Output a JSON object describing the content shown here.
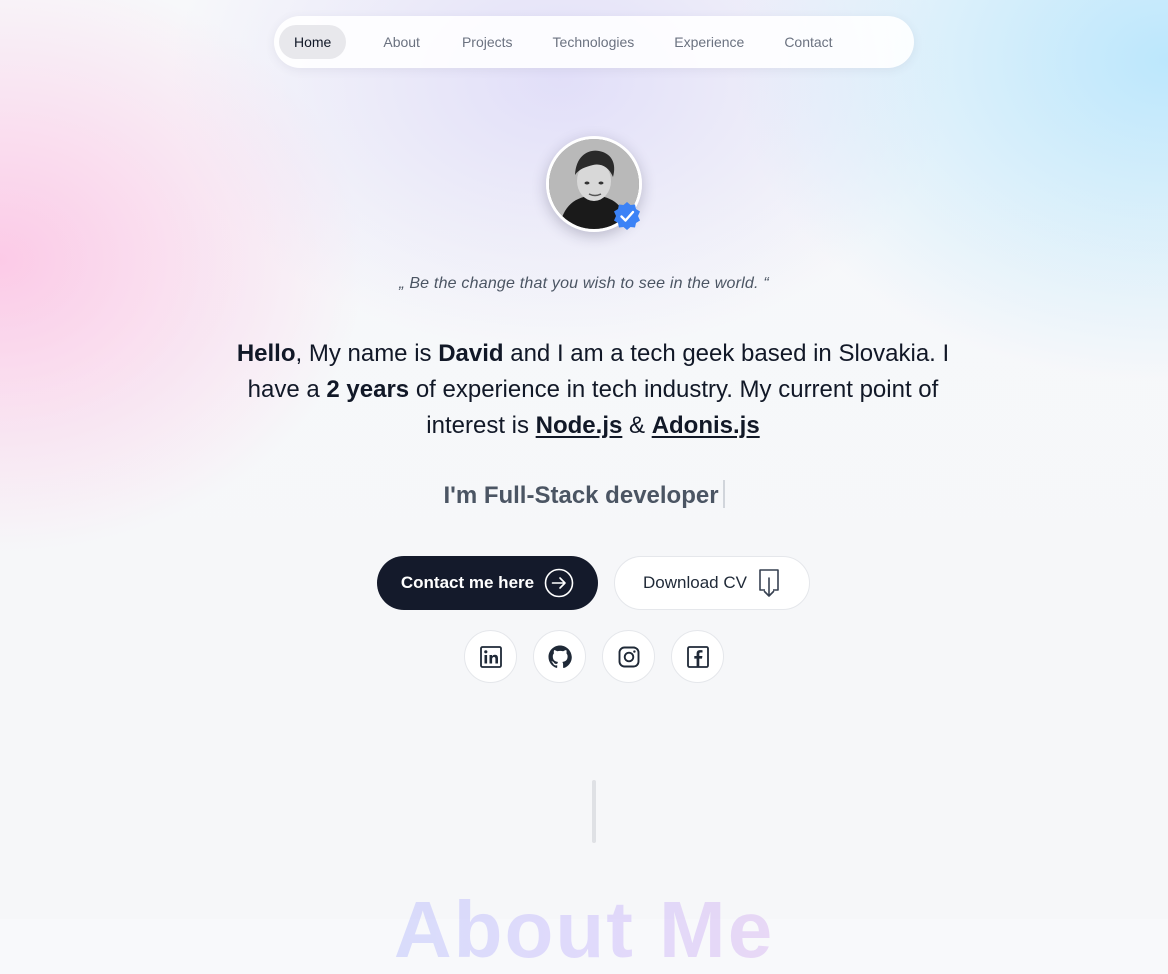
{
  "nav": {
    "items": [
      {
        "label": "Home",
        "active": true
      },
      {
        "label": "About",
        "active": false
      },
      {
        "label": "Projects",
        "active": false
      },
      {
        "label": "Technologies",
        "active": false
      },
      {
        "label": "Experience",
        "active": false
      },
      {
        "label": "Contact",
        "active": false
      }
    ]
  },
  "profile": {
    "avatar_icon": "profile-photo",
    "badge_icon": "verified-badge-icon",
    "badge_color": "#3b82f6"
  },
  "quote": "„ Be the change that you wish to see in the world. “",
  "intro": {
    "hello": "Hello",
    "part1": ", My name is ",
    "name": "David",
    "part2": " and I am a tech geek based in Slovakia. I have a ",
    "years": "2 years",
    "part3": " of experience in tech industry. My current point of interest is ",
    "tech1": "Node.js",
    "amp": " & ",
    "tech2": "Adonis.js"
  },
  "role": "I'm Full-Stack developer",
  "buttons": {
    "contact_label": "Contact me here",
    "contact_icon": "arrow-right-circle-icon",
    "cv_label": "Download CV",
    "cv_icon": "download-icon"
  },
  "social": [
    {
      "name": "linkedin",
      "icon": "linkedin-icon"
    },
    {
      "name": "github",
      "icon": "github-icon"
    },
    {
      "name": "instagram",
      "icon": "instagram-icon"
    },
    {
      "name": "facebook",
      "icon": "facebook-icon"
    }
  ],
  "next_section": {
    "heading": "About Me"
  },
  "colors": {
    "primary_button": "#141a2b",
    "text": "#111827",
    "muted": "#4b5563"
  }
}
